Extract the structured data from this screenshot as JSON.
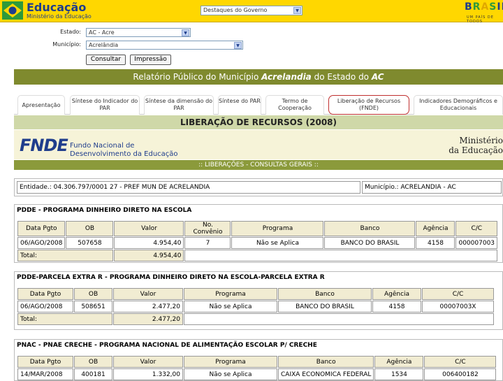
{
  "header": {
    "title": "Educação",
    "subtitle": "Ministério da Educação",
    "destaques_select": "Destaques do Governo",
    "brasil": "BRASIL",
    "brasil_sub": "UM PAÍS DE TODOS"
  },
  "filters": {
    "estado_label": "Estado:",
    "estado_value": "AC - Acre",
    "municipio_label": "Município:",
    "municipio_value": "Acrelândia",
    "consultar": "Consultar",
    "impressao": "Impressão"
  },
  "report_title": {
    "prefix": "Relatório Público do Município",
    "municipio": "Acrelandia",
    "middle": "do Estado do",
    "uf": "AC"
  },
  "tabs": [
    {
      "label": "Apresentação"
    },
    {
      "label": "Síntese do Indicador do PAR"
    },
    {
      "label": "Síntese da dimensão do PAR"
    },
    {
      "label": "Síntese do PAR"
    },
    {
      "label": "Termo de Cooperação"
    },
    {
      "label": "Liberação de Recursos (FNDE)"
    },
    {
      "label": "Indicadores Demográficos e Educacionais"
    }
  ],
  "liberacao_title": "LIBERAÇÃO DE RECURSOS (2008)",
  "fnde": {
    "logo": "FNDE",
    "name_line1": "Fundo Nacional de",
    "name_line2": "Desenvolvimento da Educação",
    "minist_line1": "Ministério",
    "minist_line2": "da Educação"
  },
  "consultas_title": ":: LIBERAÇÕES - CONSULTAS GERAIS ::",
  "entidade": "Entidade.: 04.306.797/0001 27 - PREF MUN DE ACRELANDIA",
  "municipio": "Município.: ACRELANDIA - AC",
  "pdde": {
    "title": "PDDE - PROGRAMA DINHEIRO DIRETO NA ESCOLA",
    "headers": [
      "Data Pgto",
      "OB",
      "Valor",
      "No. Convênio",
      "Programa",
      "Banco",
      "Agência",
      "C/C"
    ],
    "rows": [
      [
        "06/AGO/2008",
        "507658",
        "4.954,40",
        "7",
        "Não se Aplica",
        "BANCO DO BRASIL",
        "4158",
        "000007003"
      ]
    ],
    "total_label": "Total:",
    "total_value": "4.954,40"
  },
  "pdde_extra": {
    "title": "PDDE-PARCELA EXTRA R - PROGRAMA DINHEIRO DIRETO NA ESCOLA-PARCELA EXTRA R",
    "headers": [
      "Data Pgto",
      "OB",
      "Valor",
      "Programa",
      "Banco",
      "Agência",
      "C/C"
    ],
    "rows": [
      [
        "06/AGO/2008",
        "508651",
        "2.477,20",
        "Não se Aplica",
        "BANCO DO BRASIL",
        "4158",
        "00007003X"
      ]
    ],
    "total_label": "Total:",
    "total_value": "2.477,20"
  },
  "pnac": {
    "title": "PNAC - PNAE CRECHE - PROGRAMA NACIONAL DE ALIMENTAÇÃO ESCOLAR P/ CRECHE",
    "headers": [
      "Data Pgto",
      "OB",
      "Valor",
      "Programa",
      "Banco",
      "Agência",
      "C/C"
    ],
    "rows": [
      [
        "14/MAR/2008",
        "400181",
        "1.332,00",
        "Não se Aplica",
        "CAIXA ECONOMICA FEDERAL",
        "1534",
        "006400182"
      ]
    ]
  }
}
